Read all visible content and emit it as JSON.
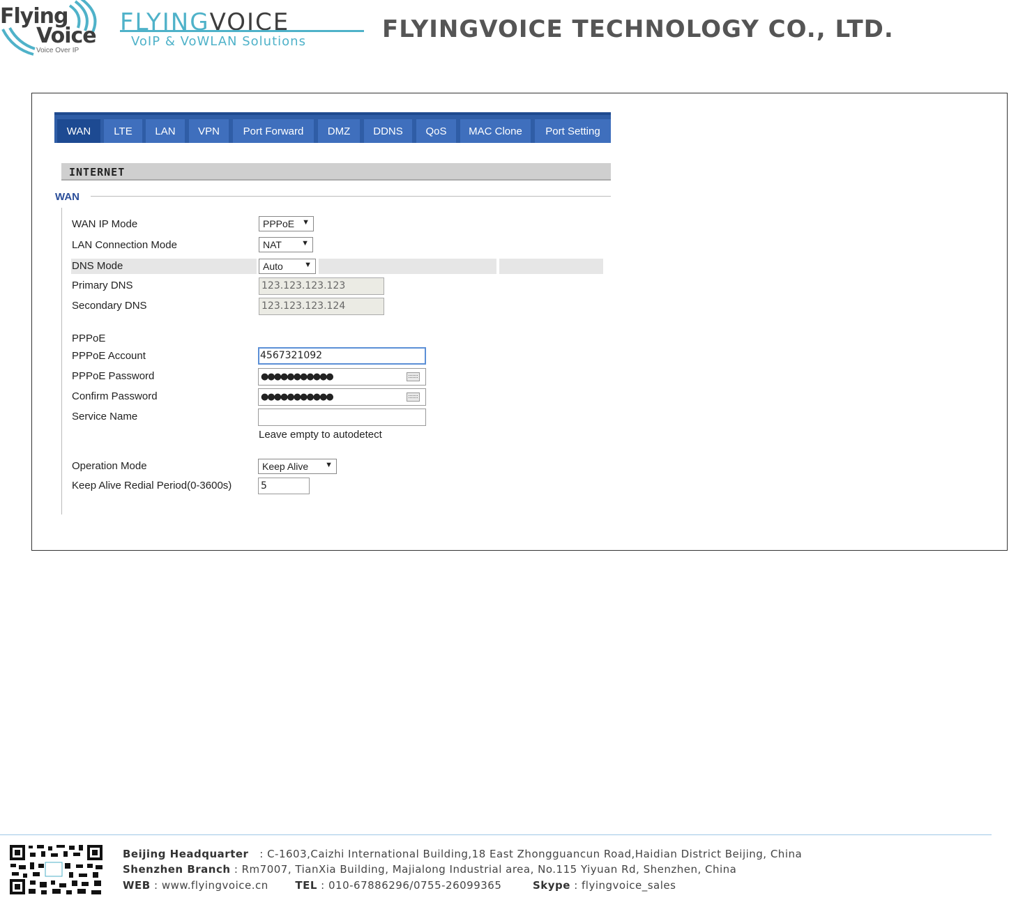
{
  "header": {
    "logo_line1": "Flying",
    "logo_line2": "Voice",
    "logo_tagline": "Voice Over IP",
    "brand_flying": "FLYING",
    "brand_voice": "VOICE",
    "brand_sub": "VoIP & VoWLAN Solutions",
    "company": "FLYINGVOICE TECHNOLOGY CO., LTD."
  },
  "tabs": [
    "WAN",
    "LTE",
    "LAN",
    "VPN",
    "Port Forward",
    "DMZ",
    "DDNS",
    "QoS",
    "MAC Clone",
    "Port Setting"
  ],
  "active_tab": "WAN",
  "section": {
    "title": "INTERNET",
    "subtitle": "WAN"
  },
  "form": {
    "wan_ip_mode": {
      "label": "WAN IP Mode",
      "value": "PPPoE"
    },
    "lan_connection_mode": {
      "label": "LAN Connection Mode",
      "value": "NAT"
    },
    "dns_mode": {
      "label": "DNS Mode",
      "value": "Auto"
    },
    "primary_dns": {
      "label": "Primary DNS",
      "value": "123.123.123.123"
    },
    "secondary_dns": {
      "label": "Secondary DNS",
      "value": "123.123.123.124"
    },
    "pppoe_heading": "PPPoE",
    "pppoe_account": {
      "label": "PPPoE Account",
      "value": "4567321092"
    },
    "pppoe_password": {
      "label": "PPPoE Password",
      "value": "●●●●●●●●●●●"
    },
    "confirm_password": {
      "label": "Confirm Password",
      "value": "●●●●●●●●●●●"
    },
    "service_name": {
      "label": "Service Name",
      "value": "",
      "hint": "Leave empty to autodetect"
    },
    "operation_mode": {
      "label": "Operation Mode",
      "value": "Keep Alive"
    },
    "keep_alive_period": {
      "label": "Keep Alive Redial Period(0-3600s)",
      "value": "5"
    }
  },
  "footer": {
    "hq_label": "Beijing Headquarter",
    "hq_text": " : C-1603,Caizhi International Building,18 East Zhongguancun Road,Haidian District Beijing, China",
    "sz_label": "Shenzhen Branch",
    "sz_text": ": Rm7007, TianXia Building, Majialong Industrial area, No.115 Yiyuan Rd, Shenzhen, China",
    "web_label": "WEB",
    "web_text": ": www.flyingvoice.cn",
    "tel_label": "TEL",
    "tel_text": ": 010-67886296/0755-26099365",
    "skype_label": "Skype",
    "skype_text": ": flyingvoice_sales"
  },
  "colors": {
    "tab_bar": "#2f5da6",
    "tab": "#3f6fbd",
    "tab_active": "#1d4a92",
    "brand_accent": "#4fb2c9",
    "wan_title": "#2b4e9a"
  }
}
